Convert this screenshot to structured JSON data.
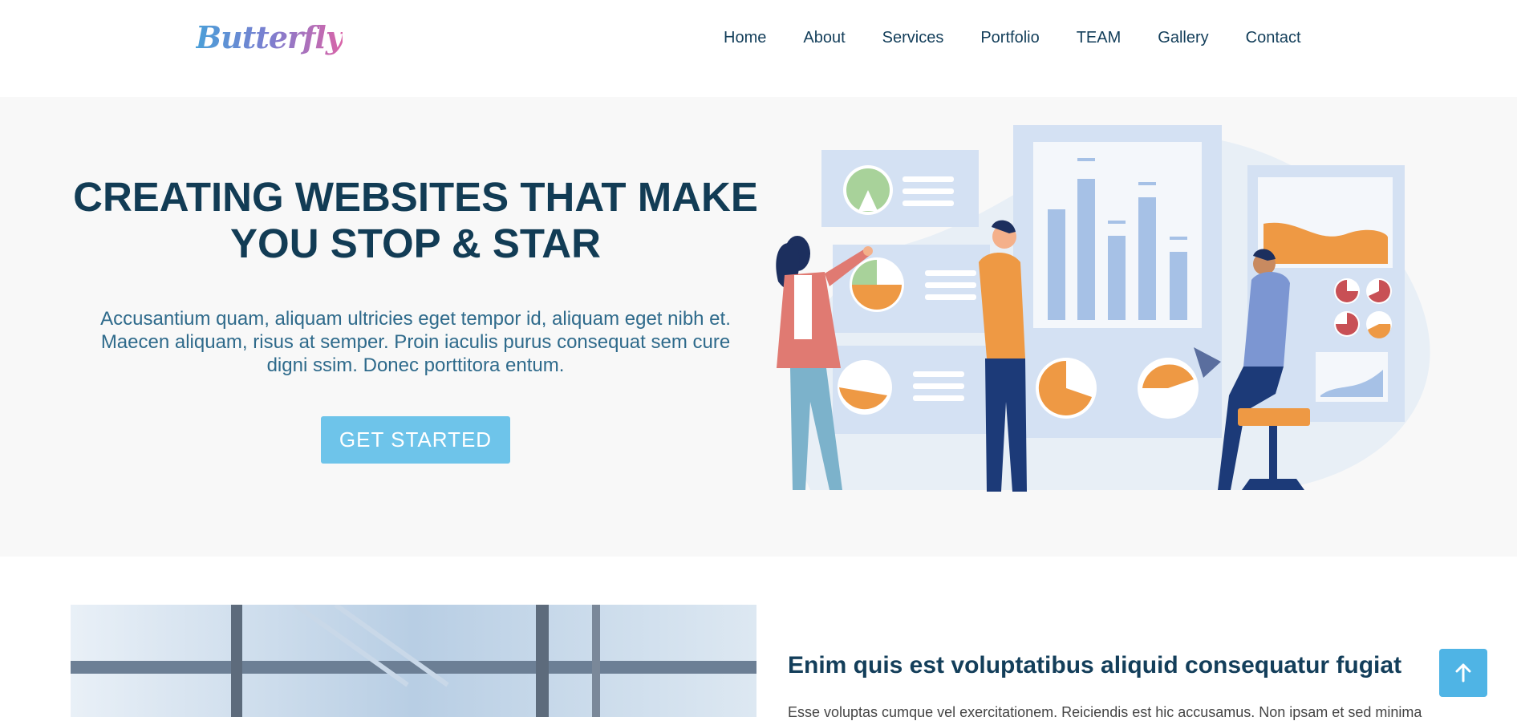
{
  "header": {
    "logo": "Butterfly",
    "nav": [
      "Home",
      "About",
      "Services",
      "Portfolio",
      "TEAM",
      "Gallery",
      "Contact"
    ]
  },
  "hero": {
    "title_line1": "CREATING WEBSITES THAT MAKE",
    "title_line2": "YOU STOP & STAR",
    "text": "Accusantium quam, aliquam ultricies eget tempor id, aliquam eget nibh et. Maecen aliquam, risus at semper. Proin iaculis purus consequat sem cure digni ssim. Donec porttitora entum.",
    "cta": "GET STARTED"
  },
  "about": {
    "title": "Enim quis est voluptatibus aliquid consequatur fugiat",
    "text": "Esse voluptas cumque vel exercitationem. Reiciendis est hic accusamus. Non ipsam et sed minima"
  },
  "colors": {
    "accent": "#6ec4ea",
    "title": "#123c55",
    "hero_bg": "#f8f8f8",
    "back_to_top": "#4fb4e5"
  },
  "icons": {
    "back_to_top": "arrow-up-icon"
  }
}
